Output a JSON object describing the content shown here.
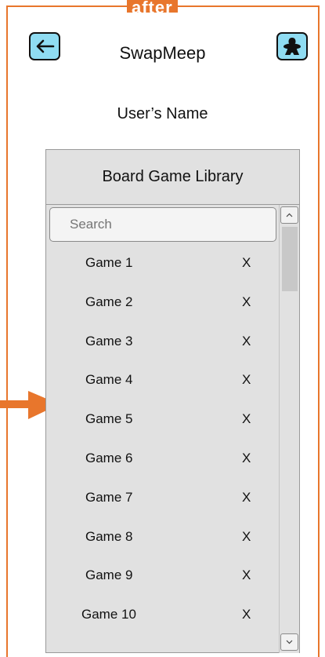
{
  "annotation": {
    "frame_label": "after"
  },
  "header": {
    "app_title": "SwapMeep",
    "back_icon": "left-arrow-icon",
    "profile_icon": "meeple-icon"
  },
  "user": {
    "name": "User’s Name"
  },
  "library": {
    "title": "Board Game Library",
    "search_placeholder": "Search",
    "remove_label": "X",
    "games": [
      {
        "name": "Game 1"
      },
      {
        "name": "Game 2"
      },
      {
        "name": "Game 3"
      },
      {
        "name": "Game 4"
      },
      {
        "name": "Game 5"
      },
      {
        "name": "Game 6"
      },
      {
        "name": "Game 7"
      },
      {
        "name": "Game 8"
      },
      {
        "name": "Game 9"
      },
      {
        "name": "Game 10"
      }
    ]
  },
  "colors": {
    "annotation_accent": "#e8762c",
    "icon_button_fill": "#8fdcf2",
    "panel_background": "#e1e1e1"
  }
}
